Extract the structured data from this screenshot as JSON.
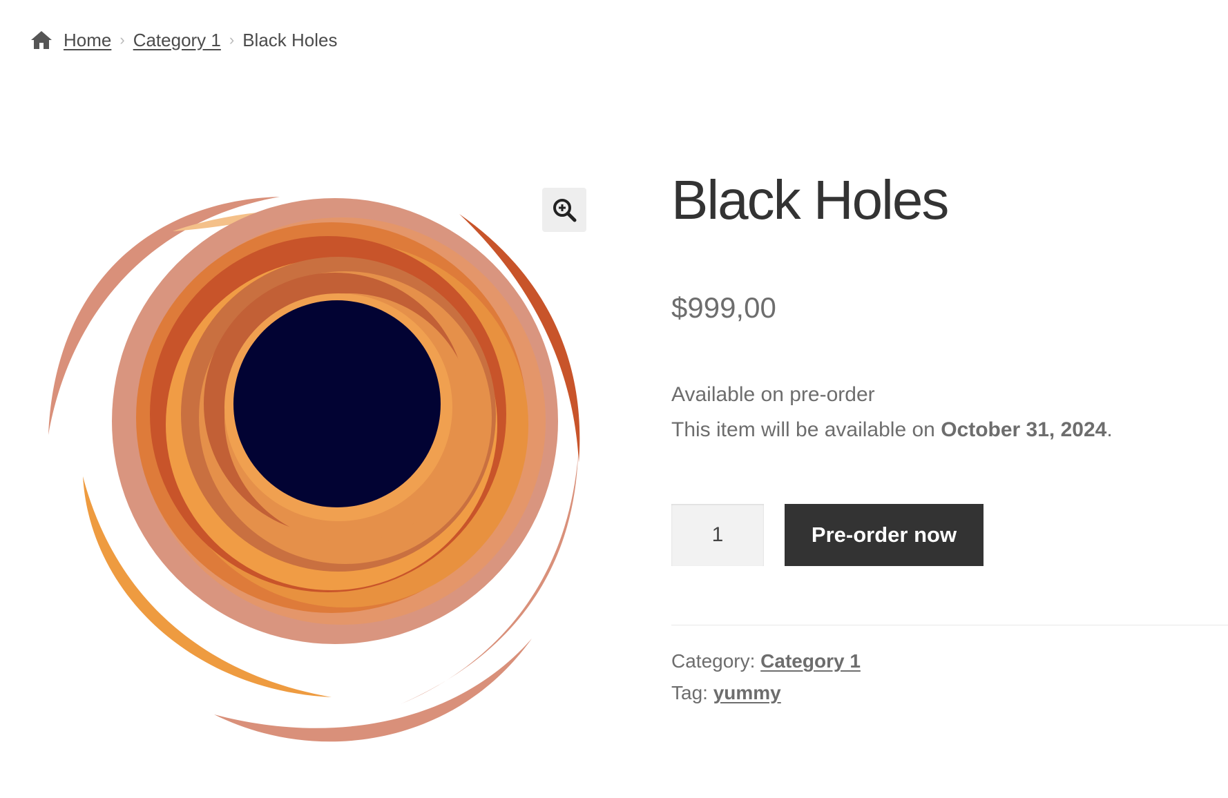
{
  "breadcrumb": {
    "home_icon": "home-icon",
    "items": [
      "Home",
      "Category 1"
    ],
    "current": "Black Holes",
    "separator_icon": "chevron-right-icon"
  },
  "gallery": {
    "zoom_icon": "zoom-in-icon",
    "image": "black-hole-illustration"
  },
  "product": {
    "title": "Black Holes",
    "price": "$999,00",
    "availability": "Available on pre-order",
    "note_prefix": "This item will be available on ",
    "note_date": "October 31, 2024",
    "note_suffix": ".",
    "quantity": "1",
    "button_label": "Pre-order now"
  },
  "meta": {
    "category_label": "Category: ",
    "category_value": "Category 1",
    "tag_label": "Tag: ",
    "tag_value": "yummy"
  },
  "colors": {
    "button_bg": "#333333",
    "title": "#333333",
    "text": "#6d6d6d",
    "black_hole_core": "#020333",
    "orange": "#e8913f",
    "salmon": "#d9907a",
    "rust": "#c8542a"
  }
}
